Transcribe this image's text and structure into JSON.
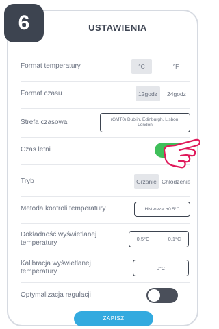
{
  "step_number": "6",
  "screen_title": "USTAWIENIA",
  "settings": {
    "temp_format": {
      "label": "Format temperatury",
      "options": [
        "°C",
        "°F"
      ],
      "selected": "°C"
    },
    "time_format": {
      "label": "Format czasu",
      "options": [
        "12godz",
        "24godz"
      ],
      "selected": "12godz"
    },
    "timezone": {
      "label": "Strefa czasowa",
      "value": "(GMT0) Dublin, Edinburgh, Lisbon, London"
    },
    "dst": {
      "label": "Czas letni",
      "state": "on"
    },
    "mode": {
      "label": "Tryb",
      "options": [
        "Grzanie",
        "Chłodzenie"
      ],
      "selected": "Grzanie"
    },
    "temp_control": {
      "label": "Metoda kontroli temperatury",
      "value": "Histereza: ±0.5°C"
    },
    "display_precision": {
      "label": "Dokładność wyświetlanej temperatury",
      "options": [
        "0.5°C",
        "0.1°C"
      ],
      "selected": "0.5°C"
    },
    "calibration": {
      "label": "Kalibracja wyświetlanej temperatury",
      "value": "0°C"
    },
    "optimization": {
      "label": "Optymalizacja regulacji",
      "state": "off"
    }
  },
  "save_label": "ZAPISZ",
  "colors": {
    "toggle_on": "#3fbf5a",
    "toggle_off": "#4a4f5a",
    "save_button": "#33aadf",
    "hand_outline": "#e0195b"
  },
  "icons": [
    "pointing-hand-icon"
  ]
}
